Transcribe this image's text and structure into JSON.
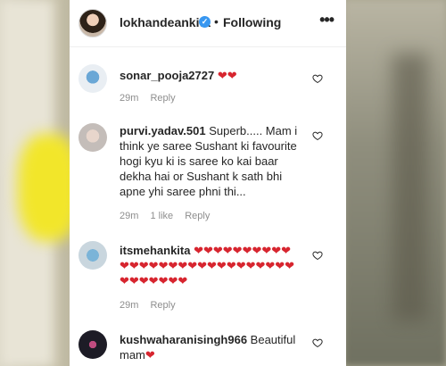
{
  "post": {
    "username": "lokhandeankita",
    "verified_glyph": "✓",
    "separator": "•",
    "following": "Following",
    "more_glyph": "•••"
  },
  "comments": [
    {
      "username": "sonar_pooja2727",
      "text": " ",
      "hearts": "❤❤",
      "time": "29m",
      "likes": "",
      "reply": "Reply"
    },
    {
      "username": "purvi.yadav.501",
      "text": " Superb..... Mam i think ye saree Sushant ki favourite hogi kyu ki is saree ko kai baar dekha hai or Sushant k sath bhi apne yhi saree phni thi...",
      "hearts": "",
      "time": "29m",
      "likes": "1 like",
      "reply": "Reply"
    },
    {
      "username": "itsmehankita",
      "text": " ",
      "hearts": "❤❤❤❤❤❤❤❤❤❤❤❤❤❤❤❤❤❤❤❤❤❤❤❤❤❤❤❤❤❤❤❤❤❤❤",
      "time": "29m",
      "likes": "",
      "reply": "Reply"
    },
    {
      "username": "kushwaharanisingh966",
      "text": " Beautiful mam",
      "hearts": "❤",
      "time": "",
      "likes": "",
      "reply": ""
    }
  ],
  "icons": {
    "header_avatar": "profile-avatar",
    "verified": "verified-badge-icon",
    "more": "more-options-icon",
    "like": "heart-outline-icon"
  },
  "colors": {
    "verified": "#3897f0",
    "heart": "#d7252f",
    "muted": "#8e8e8e",
    "text": "#262626"
  }
}
